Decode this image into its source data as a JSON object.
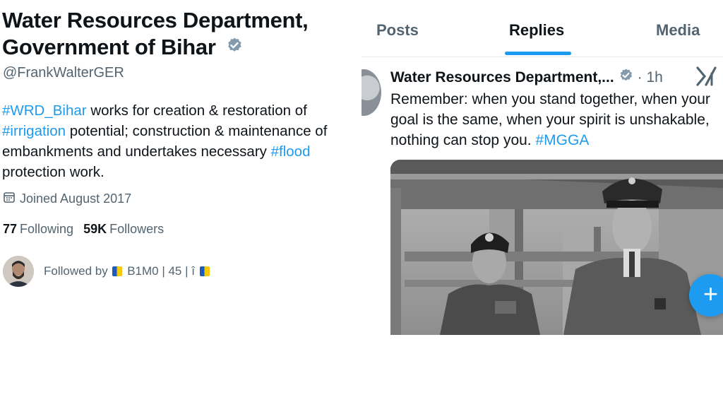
{
  "profile": {
    "name_line1": "Water Resources Department,",
    "name_line2": "Government of Bihar",
    "handle": "@FrankWalterGER",
    "bio": {
      "tag1": "#WRD_Bihar",
      "text1": " works for creation & restoration of ",
      "tag2": "#irrigation",
      "text2": " potential; construction & maintenance of embankments and undertakes necessary ",
      "tag3": "#flood",
      "text3": " protection work."
    },
    "joined": "Joined August 2017",
    "following_count": "77",
    "following_label": "Following",
    "followers_count": "59K",
    "followers_label": "Followers",
    "followed_by_prefix": "Followed by",
    "followed_by_name": "B1M0 | 45 | î"
  },
  "tabs": [
    "Posts",
    "Replies",
    "Media"
  ],
  "active_tab": "Replies",
  "post": {
    "author": "Water Resources Department,...",
    "time": "· 1h",
    "text_main": "Remember: when you stand together, when your goal is the same, when your spirit is unshakable, nothing can stop you. ",
    "hashtag": "#MGGA"
  },
  "fab_label": "+",
  "colors": {
    "accent": "#1d9bf0",
    "muted": "#536471",
    "text": "#0f1419",
    "verified": "#829aab"
  },
  "icons": {
    "verified": "verified-badge-icon",
    "calendar": "calendar-icon",
    "x_grok": "x-grok-icon",
    "compose": "plus-icon"
  }
}
